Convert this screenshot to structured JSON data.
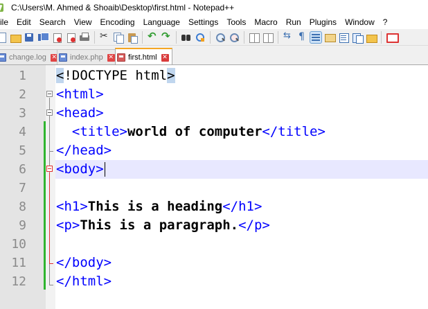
{
  "window": {
    "title": "C:\\Users\\M. Ahmed & Shoaib\\Desktop\\first.html - Notepad++"
  },
  "menu": [
    "ile",
    "Edit",
    "Search",
    "View",
    "Encoding",
    "Language",
    "Settings",
    "Tools",
    "Macro",
    "Run",
    "Plugins",
    "Window",
    "?"
  ],
  "toolbar": {
    "icons": [
      "new-file-icon",
      "open-file-icon",
      "save-icon",
      "save-all-icon",
      "close-file-icon",
      "close-all-icon",
      "print-icon",
      "cut-icon",
      "copy-icon",
      "paste-icon",
      "undo-icon",
      "redo-icon",
      "find-icon",
      "replace-icon",
      "zoom-in-icon",
      "zoom-out-icon",
      "sync-scroll-icon",
      "word-wrap-icon",
      "show-all-characters-icon",
      "indent-guide-icon",
      "user-defined-language-icon",
      "document-map-icon",
      "function-list-icon",
      "folder-as-workspace-icon",
      "monitoring-icon"
    ],
    "active_icon": "indent-guide-icon"
  },
  "tabs": [
    {
      "label": "change.log",
      "active": false
    },
    {
      "label": "index.php",
      "active": false
    },
    {
      "label": "first.html",
      "active": true
    }
  ],
  "tab_close_glyph": "✕",
  "editor": {
    "current_line": 6,
    "lines": [
      {
        "num": "1",
        "parts": [
          {
            "t": "<",
            "c": "doctype"
          },
          {
            "t": "!DOCTYPE html",
            "c": "doctype"
          },
          {
            "t": ">",
            "c": "doctype"
          }
        ]
      },
      {
        "num": "2",
        "parts": [
          {
            "t": "<html>",
            "c": "tag"
          }
        ]
      },
      {
        "num": "3",
        "parts": [
          {
            "t": "<head>",
            "c": "tag"
          }
        ]
      },
      {
        "num": "4",
        "parts": [
          {
            "t": "  <title>",
            "c": "tag"
          },
          {
            "t": "world of computer",
            "c": "txt"
          },
          {
            "t": "</title>",
            "c": "tag"
          }
        ]
      },
      {
        "num": "5",
        "parts": [
          {
            "t": "</head>",
            "c": "tag"
          }
        ]
      },
      {
        "num": "6",
        "parts": [
          {
            "t": "<body>",
            "c": "tag"
          }
        ]
      },
      {
        "num": "7",
        "parts": []
      },
      {
        "num": "8",
        "parts": [
          {
            "t": "<h1>",
            "c": "tag"
          },
          {
            "t": "This is a heading",
            "c": "txt"
          },
          {
            "t": "</h1>",
            "c": "tag"
          }
        ]
      },
      {
        "num": "9",
        "parts": [
          {
            "t": "<p>",
            "c": "tag"
          },
          {
            "t": "This is a paragraph.",
            "c": "txt"
          },
          {
            "t": "</p>",
            "c": "tag"
          }
        ]
      },
      {
        "num": "10",
        "parts": []
      },
      {
        "num": "11",
        "parts": [
          {
            "t": "</body>",
            "c": "tag"
          }
        ]
      },
      {
        "num": "12",
        "parts": [
          {
            "t": "</html>",
            "c": "tag"
          }
        ]
      }
    ]
  },
  "colors": {
    "tag": "#0000ff",
    "text": "#000000",
    "current_line": "#e8e8ff",
    "selection": "#c0d6ee",
    "change_bar": "#2fb52f",
    "active_fold": "#e03030"
  }
}
